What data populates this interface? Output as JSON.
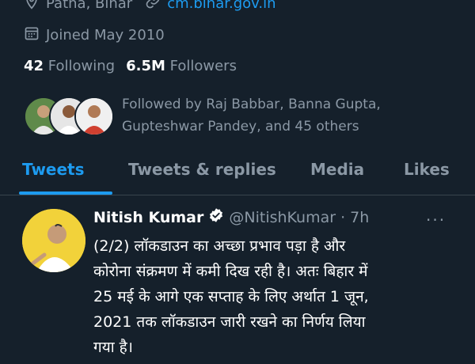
{
  "profile": {
    "location": "Patna, Bihar",
    "website": "cm.bihar.gov.in",
    "joined": "Joined May 2010",
    "following_count": "42",
    "following_label": "Following",
    "followers_count": "6.5M",
    "followers_label": "Followers",
    "followed_by": "Followed by Raj Babbar, Banna Gupta, Gupteshwar Pandey, and 45 others"
  },
  "tabs": [
    {
      "label": "Tweets",
      "active": true
    },
    {
      "label": "Tweets & replies",
      "active": false
    },
    {
      "label": "Media",
      "active": false
    },
    {
      "label": "Likes",
      "active": false
    }
  ],
  "tweet": {
    "author_name": "Nitish Kumar",
    "handle": "@NitishKumar",
    "separator": "·",
    "time": "7h",
    "more_label": "···",
    "text": "(2/2) लॉकडाउन का अच्छा प्रभाव पड़ा है और\nकोरोना संक्रमण में कमी दिख रही है। अतः बिहार में\n25 मई के आगे एक सप्ताह के लिए अर्थात 1 जून,\n2021 तक लॉकडाउन जारी रखने का निर्णय लिया\nगया है।"
  },
  "colors": {
    "background": "#15202b",
    "accent": "#1d9bf0",
    "muted": "#8b98a5",
    "divider": "#38444d"
  },
  "icons": [
    "location-icon",
    "link-icon",
    "calendar-icon",
    "verified-icon",
    "more-icon"
  ]
}
